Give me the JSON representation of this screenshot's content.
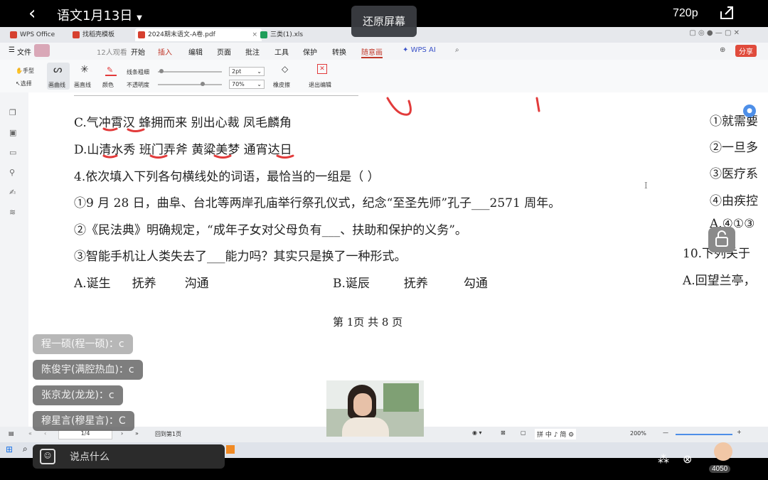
{
  "stream": {
    "title": "语文1月13日",
    "restore_label": "还原屏幕",
    "quality": "720p",
    "viewer_count": "12人观看",
    "likes": "4050"
  },
  "wps": {
    "tabs": [
      {
        "label": "WPS Office",
        "color": "#d6402f"
      },
      {
        "label": "找稻壳模板",
        "color": "#d6402f"
      },
      {
        "label": "2024期末语文-A卷.pdf",
        "color": "#d6402f"
      },
      {
        "label": "三类(1).xls",
        "color": "#1e9e5a"
      }
    ],
    "menu": [
      "文件",
      "开始",
      "插入",
      "编辑",
      "页面",
      "批注",
      "工具",
      "保护",
      "转换",
      "随意画",
      "WPS AI"
    ],
    "share_label": "分享",
    "toolbar": {
      "hand": "手型",
      "select": "选择",
      "curve": "画曲线",
      "line": "画直线",
      "color": "颜色",
      "thickness_label": "线条粗细",
      "thickness_value": "2pt",
      "opacity_label": "不透明度",
      "opacity_value": "70%",
      "eraser": "橡皮擦",
      "exit": "退出编辑"
    }
  },
  "document": {
    "lines": [
      "C.气冲霄汉  蜂拥而来  别出心裁  凤毛麟角",
      "D.山清水秀  班门弄斧  黄粱美梦  通宵达日",
      "4.依次填入下列各句横线处的词语，最恰当的一组是（     ）",
      "①9 月 28 日，曲阜、台北等两岸孔庙举行祭孔仪式，纪念“至圣先师”孔子___2571 周年。",
      "②《民法典》明确规定，“成年子女对父母负有___、扶助和保护的义务”。",
      "③智能手机让人类失去了___能力吗？其实只是换了一种形式。"
    ],
    "option_a": [
      "A.诞生",
      "抚养",
      "沟通"
    ],
    "option_b": [
      "B.诞辰",
      "抚养",
      "勾通"
    ],
    "footer": "第 1页  共 8 页",
    "right_col": [
      "①就需要",
      "②一旦多",
      "③医疗系",
      "④由疾控",
      "A.④①③",
      "10.下列关于",
      "A.回望兰亭，"
    ]
  },
  "status": {
    "page": "1/4",
    "back_to_first": "回到第1页",
    "zoom": "200%",
    "ime": "拼 中 ♪ 简 ⚙"
  },
  "chat": [
    {
      "text": "程一硕(程一硕)：c"
    },
    {
      "text": "陈俊宇(满腔热血)：c"
    },
    {
      "text": "张京龙(龙龙)：c"
    },
    {
      "text": "穆星言(穆星言)：C"
    }
  ],
  "input_placeholder": "说点什么",
  "colors": {
    "annotation": "#e23b3b",
    "accent": "#c0392b"
  }
}
